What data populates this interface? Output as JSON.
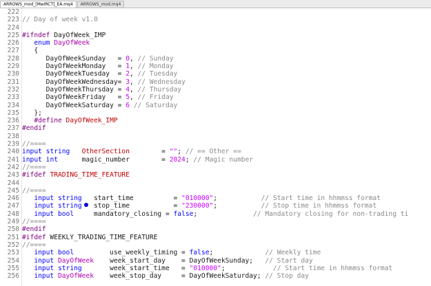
{
  "tabs": [
    {
      "label": "ARROWS_mod_[MwIRCT]_EA.mq4",
      "active": true
    },
    {
      "label": "ARROWS_mod.mq4",
      "active": false
    }
  ],
  "lines": [
    {
      "n": "222",
      "tokens": []
    },
    {
      "n": "223",
      "tokens": [
        {
          "c": "cm",
          "t": "// Day of week v1.0"
        }
      ]
    },
    {
      "n": "224",
      "tokens": []
    },
    {
      "n": "225",
      "tokens": [
        {
          "c": "pp",
          "t": "#ifndef"
        },
        {
          "c": "",
          "t": " DayOfWeek_IMP"
        }
      ]
    },
    {
      "n": "226",
      "tokens": [
        {
          "c": "",
          "t": "   "
        },
        {
          "c": "kw",
          "t": "enum"
        },
        {
          "c": "",
          "t": " "
        },
        {
          "c": "ty",
          "t": "DayOfWeek"
        }
      ]
    },
    {
      "n": "227",
      "tokens": [
        {
          "c": "",
          "t": "   {"
        }
      ]
    },
    {
      "n": "228",
      "tokens": [
        {
          "c": "",
          "t": "      DayOfWeekSunday   = "
        },
        {
          "c": "num",
          "t": "0"
        },
        {
          "c": "",
          "t": ", "
        },
        {
          "c": "cm",
          "t": "// Sunday"
        }
      ]
    },
    {
      "n": "229",
      "tokens": [
        {
          "c": "",
          "t": "      DayOfWeekMonday   = "
        },
        {
          "c": "num",
          "t": "1"
        },
        {
          "c": "",
          "t": ", "
        },
        {
          "c": "cm",
          "t": "// Monday"
        }
      ]
    },
    {
      "n": "230",
      "tokens": [
        {
          "c": "",
          "t": "      DayOfWeekTuesday  = "
        },
        {
          "c": "num",
          "t": "2"
        },
        {
          "c": "",
          "t": ", "
        },
        {
          "c": "cm",
          "t": "// Tuesday"
        }
      ]
    },
    {
      "n": "231",
      "tokens": [
        {
          "c": "",
          "t": "      DayOfWeekWednesday= "
        },
        {
          "c": "num",
          "t": "3"
        },
        {
          "c": "",
          "t": ", "
        },
        {
          "c": "cm",
          "t": "// Wednesday"
        }
      ]
    },
    {
      "n": "232",
      "tokens": [
        {
          "c": "",
          "t": "      DayOfWeekThursday = "
        },
        {
          "c": "num",
          "t": "4"
        },
        {
          "c": "",
          "t": ", "
        },
        {
          "c": "cm",
          "t": "// Thursday"
        }
      ]
    },
    {
      "n": "233",
      "tokens": [
        {
          "c": "",
          "t": "      DayOfWeekFriday   = "
        },
        {
          "c": "num",
          "t": "5"
        },
        {
          "c": "",
          "t": ", "
        },
        {
          "c": "cm",
          "t": "// Friday"
        }
      ]
    },
    {
      "n": "234",
      "tokens": [
        {
          "c": "",
          "t": "      DayOfWeekSaturday = "
        },
        {
          "c": "num",
          "t": "6"
        },
        {
          "c": "",
          "t": " "
        },
        {
          "c": "cm",
          "t": "// Saturday"
        }
      ]
    },
    {
      "n": "235",
      "tokens": [
        {
          "c": "",
          "t": "   };"
        }
      ]
    },
    {
      "n": "236",
      "tokens": [
        {
          "c": "",
          "t": "   "
        },
        {
          "c": "pp",
          "t": "#define"
        },
        {
          "c": "",
          "t": " "
        },
        {
          "c": "id",
          "t": "DayOfWeek_IMP"
        }
      ]
    },
    {
      "n": "237",
      "tokens": [
        {
          "c": "pp",
          "t": "#endif"
        }
      ]
    },
    {
      "n": "238",
      "tokens": []
    },
    {
      "n": "239",
      "tokens": [
        {
          "c": "cm",
          "t": "//===="
        }
      ]
    },
    {
      "n": "240",
      "tokens": [
        {
          "c": "kw",
          "t": "input"
        },
        {
          "c": "",
          "t": " "
        },
        {
          "c": "kw",
          "t": "string"
        },
        {
          "c": "",
          "t": "   "
        },
        {
          "c": "id",
          "t": "OtherSection"
        },
        {
          "c": "",
          "t": "        = "
        },
        {
          "c": "str",
          "t": "\"\""
        },
        {
          "c": "",
          "t": "; "
        },
        {
          "c": "cm",
          "t": "// == Other =="
        }
      ]
    },
    {
      "n": "241",
      "tokens": [
        {
          "c": "kw",
          "t": "input"
        },
        {
          "c": "",
          "t": " "
        },
        {
          "c": "kw",
          "t": "int"
        },
        {
          "c": "",
          "t": "      "
        },
        {
          "c": "",
          "t": "magic_number"
        },
        {
          "c": "",
          "t": "        = "
        },
        {
          "c": "num",
          "t": "2024"
        },
        {
          "c": "",
          "t": "; "
        },
        {
          "c": "cm",
          "t": "// Magic number"
        }
      ]
    },
    {
      "n": "242",
      "tokens": [
        {
          "c": "cm",
          "t": "//===="
        }
      ]
    },
    {
      "n": "243",
      "tokens": [
        {
          "c": "pp",
          "t": "#ifdef"
        },
        {
          "c": "",
          "t": " "
        },
        {
          "c": "id",
          "t": "TRADING_TIME_FEATURE"
        }
      ]
    },
    {
      "n": "244",
      "tokens": []
    },
    {
      "n": "245",
      "tokens": [
        {
          "c": "cm",
          "t": "//===="
        }
      ]
    },
    {
      "n": "246",
      "tokens": [
        {
          "c": "",
          "t": "   "
        },
        {
          "c": "kw",
          "t": "input"
        },
        {
          "c": "",
          "t": " "
        },
        {
          "c": "kw",
          "t": "string"
        },
        {
          "c": "",
          "t": "   start_time          = "
        },
        {
          "c": "str",
          "t": "\"010000\""
        },
        {
          "c": "",
          "t": ";           "
        },
        {
          "c": "cm",
          "t": "// Start time in hhmmss format"
        }
      ]
    },
    {
      "n": "247",
      "tokens": [
        {
          "c": "",
          "t": "   "
        },
        {
          "c": "kw",
          "t": "input"
        },
        {
          "c": "",
          "t": " "
        },
        {
          "c": "kw",
          "t": "string"
        },
        {
          "c": "",
          "t": "   stop_time           = "
        },
        {
          "c": "str",
          "t": "\"230000\""
        },
        {
          "c": "",
          "t": ";           "
        },
        {
          "c": "cm",
          "t": "// Stop time in hhmmss format"
        }
      ]
    },
    {
      "n": "248",
      "tokens": [
        {
          "c": "",
          "t": "   "
        },
        {
          "c": "kw",
          "t": "input"
        },
        {
          "c": "",
          "t": " "
        },
        {
          "c": "kw",
          "t": "bool"
        },
        {
          "c": "",
          "t": "     mandatory_closing = "
        },
        {
          "c": "kw",
          "t": "false"
        },
        {
          "c": "",
          "t": ";              "
        },
        {
          "c": "cm",
          "t": "// Mandatory closing for non-trading ti"
        }
      ]
    },
    {
      "n": "249",
      "tokens": [
        {
          "c": "cm",
          "t": "//===="
        }
      ]
    },
    {
      "n": "250",
      "tokens": [
        {
          "c": "pp",
          "t": "#endif"
        }
      ]
    },
    {
      "n": "251",
      "tokens": [
        {
          "c": "pp",
          "t": "#ifdef"
        },
        {
          "c": "",
          "t": " WEEKLY_TRADING_TIME_FEATURE"
        }
      ]
    },
    {
      "n": "252",
      "tokens": [
        {
          "c": "cm",
          "t": "//===="
        }
      ]
    },
    {
      "n": "253",
      "tokens": [
        {
          "c": "",
          "t": "   "
        },
        {
          "c": "kw",
          "t": "input"
        },
        {
          "c": "",
          "t": " "
        },
        {
          "c": "kw",
          "t": "bool"
        },
        {
          "c": "",
          "t": "         use_weekly_timing = "
        },
        {
          "c": "kw",
          "t": "false"
        },
        {
          "c": "",
          "t": ";             "
        },
        {
          "c": "cm",
          "t": "// Weekly time"
        }
      ]
    },
    {
      "n": "254",
      "tokens": [
        {
          "c": "",
          "t": "   "
        },
        {
          "c": "kw",
          "t": "input"
        },
        {
          "c": "",
          "t": " "
        },
        {
          "c": "ty",
          "t": "DayOfWeek"
        },
        {
          "c": "",
          "t": "    week_start_day    = DayOfWeekSunday;   "
        },
        {
          "c": "cm",
          "t": "// Start day"
        }
      ]
    },
    {
      "n": "255",
      "tokens": [
        {
          "c": "",
          "t": "   "
        },
        {
          "c": "kw",
          "t": "input"
        },
        {
          "c": "",
          "t": " "
        },
        {
          "c": "kw",
          "t": "string"
        },
        {
          "c": "",
          "t": "       week_start_time   = "
        },
        {
          "c": "str",
          "t": "\"010000\""
        },
        {
          "c": "",
          "t": ";            "
        },
        {
          "c": "cm",
          "t": "// Start time in hhmmss format"
        }
      ]
    },
    {
      "n": "256",
      "tokens": [
        {
          "c": "",
          "t": "   "
        },
        {
          "c": "kw",
          "t": "input"
        },
        {
          "c": "",
          "t": " "
        },
        {
          "c": "ty",
          "t": "DayOfWeek"
        },
        {
          "c": "",
          "t": "    week_stop_day     = DayOfWeekSaturday; "
        },
        {
          "c": "cm",
          "t": "// Stop day"
        }
      ]
    }
  ]
}
